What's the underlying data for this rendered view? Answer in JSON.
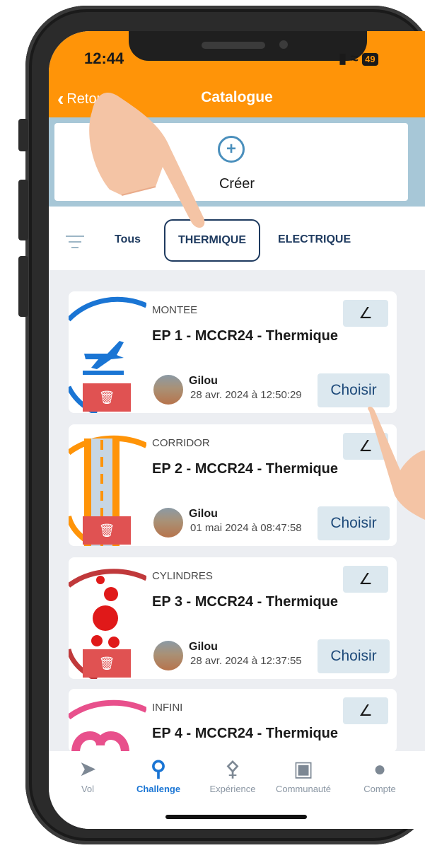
{
  "status_bar": {
    "time": "12:44",
    "battery": "49"
  },
  "header": {
    "back_label": "Retour",
    "title": "Catalogue"
  },
  "create": {
    "label": "Créer"
  },
  "filter_tabs": [
    "Tous",
    "THERMIQUE",
    "ELECTRIQUE"
  ],
  "active_tab": "THERMIQUE",
  "cards": [
    {
      "category": "MONTEE",
      "name": "EP 1 - MCCR24 - Thermique",
      "author": "Gilou",
      "date": "28 avr. 2024 à 12:50:29",
      "choose_label": "Choisir"
    },
    {
      "category": "CORRIDOR",
      "name": "EP 2 - MCCR24 - Thermique",
      "author": "Gilou",
      "date": "01 mai 2024 à 08:47:58",
      "choose_label": "Choisir"
    },
    {
      "category": "CYLINDRES",
      "name": "EP 3 - MCCR24 - Thermique",
      "author": "Gilou",
      "date": "28 avr. 2024 à 12:37:55",
      "choose_label": "Choisir"
    },
    {
      "category": "INFINI",
      "name": "EP 4 - MCCR24 - Thermique"
    }
  ],
  "bottom_nav": [
    {
      "label": "Vol",
      "icon": "paper-plane-icon"
    },
    {
      "label": "Challenge",
      "icon": "award-ribbon-icon",
      "active": true
    },
    {
      "label": "Expérience",
      "icon": "joystick-icon"
    },
    {
      "label": "Communauté",
      "icon": "community-icon"
    },
    {
      "label": "Compte",
      "icon": "user-icon"
    }
  ],
  "colors": {
    "header": "#ff9408",
    "accent": "#1a75d4",
    "navy": "#1e3a5f",
    "trash": "#e05252"
  }
}
